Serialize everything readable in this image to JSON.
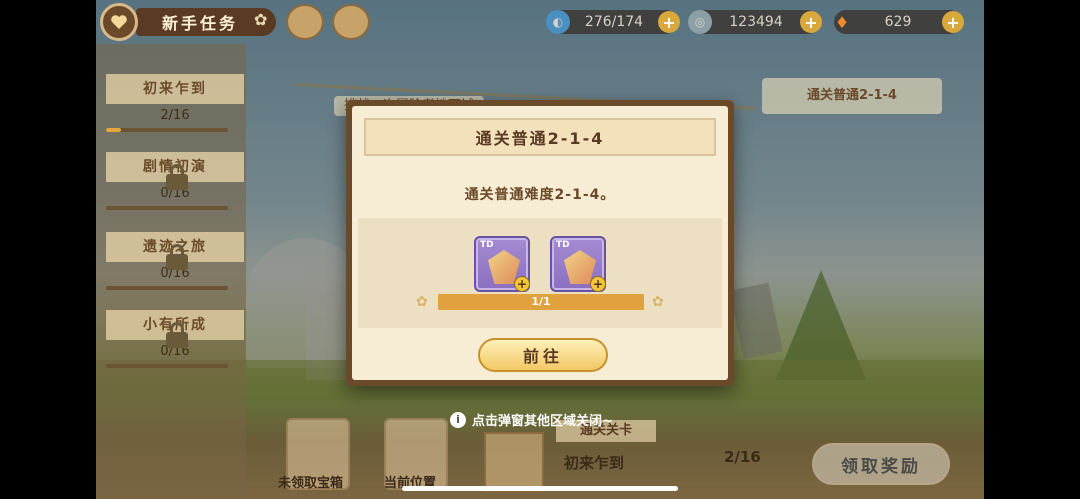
{
  "header": {
    "title": "新手任务",
    "stamina": "276/174",
    "coins": "123494",
    "carrots": "629"
  },
  "sidebar": {
    "items": [
      {
        "name": "初来乍到",
        "progress": "2/16",
        "fraction": 0.125,
        "locked": false
      },
      {
        "name": "剧情初演",
        "progress": "0/16",
        "fraction": 0,
        "locked": true
      },
      {
        "name": "遗迹之旅",
        "progress": "0/16",
        "fraction": 0,
        "locked": true
      },
      {
        "name": "小有所成",
        "progress": "0/16",
        "fraction": 0,
        "locked": true
      }
    ]
  },
  "background_cards": {
    "card1": "挑战一次冒险者地下城",
    "card2": "通关普通2-1-4"
  },
  "modal": {
    "title": "通关普通2-1-4",
    "description": "通关普通难度2-1-4。",
    "rewards": [
      {
        "tag": "TD",
        "icon": "equipment-item-icon"
      },
      {
        "tag": "TD",
        "icon": "equipment-item-icon"
      }
    ],
    "progress_text": "1/1",
    "progress_fraction": 1.0,
    "goto_label": "前往"
  },
  "hint": "点击弹窗其他区域关闭~",
  "bottom": {
    "btn1_label": "未领取宝箱",
    "btn2_label": "当前位置",
    "task_title": "通关关卡",
    "task_name": "初来乍到",
    "task_progress": "2/16",
    "claim_label": "领取奖励"
  }
}
